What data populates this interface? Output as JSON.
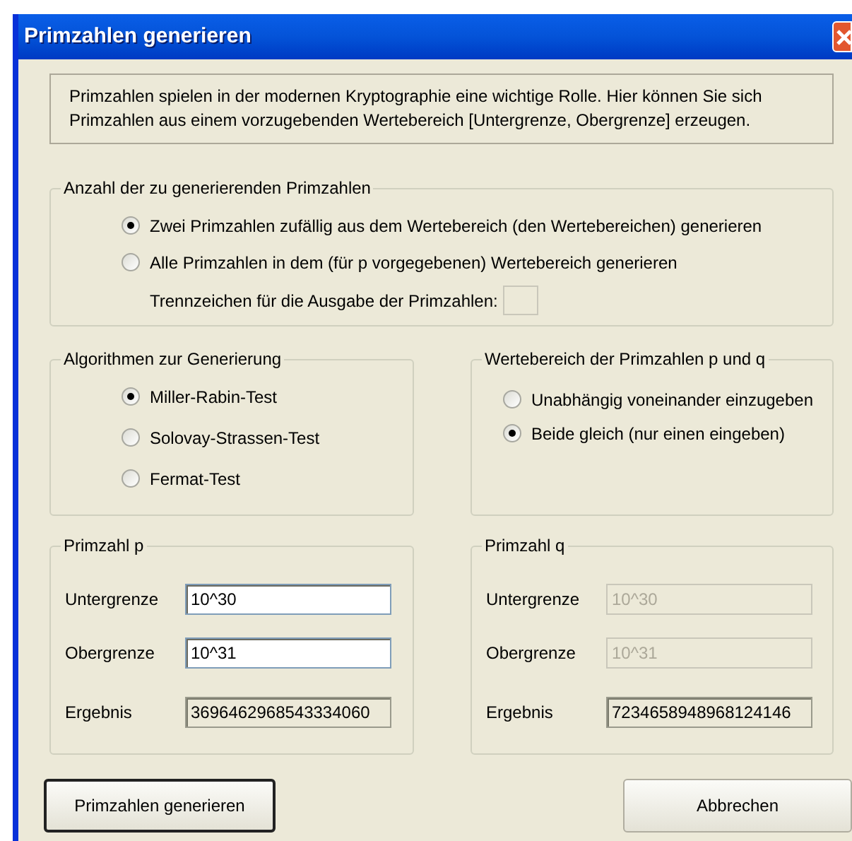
{
  "window": {
    "title": "Primzahlen generieren"
  },
  "intro": {
    "lines": [
      "Primzahlen spielen in der modernen Kryptographie eine wichtige Rolle. Hier können Sie sich",
      "Primzahlen aus einem vorzugebenden Wertebereich [Untergrenze, Obergrenze] erzeugen."
    ]
  },
  "count_group": {
    "title": "Anzahl der zu generierenden Primzahlen",
    "options": [
      {
        "label": "Zwei Primzahlen zufällig aus dem Wertebereich (den Wertebereichen) generieren",
        "selected": true
      },
      {
        "label": "Alle Primzahlen in dem (für p vorgegebenen) Wertebereich generieren",
        "selected": false
      }
    ],
    "separator": {
      "label": "Trennzeichen für die Ausgabe der Primzahlen:",
      "disabled": true
    }
  },
  "algorithm_group": {
    "title": "Algorithmen zur Generierung",
    "options": [
      {
        "label": "Miller-Rabin-Test",
        "selected": true
      },
      {
        "label": "Solovay-Strassen-Test",
        "selected": false
      },
      {
        "label": "Fermat-Test",
        "selected": false
      }
    ]
  },
  "range_group": {
    "title": "Wertebereich der Primzahlen p und q",
    "options": [
      {
        "label": "Unabhängig voneinander einzugeben",
        "selected": false
      },
      {
        "label": "Beide gleich (nur einen eingeben)",
        "selected": true
      }
    ]
  },
  "prime_groups": [
    {
      "title": "Primzahl p",
      "fields": [
        {
          "label": "Untergrenze",
          "value": "10^30",
          "kind": "input",
          "disabled": false
        },
        {
          "label": "Obergrenze",
          "value": "10^31",
          "kind": "input",
          "disabled": false
        },
        {
          "label": "Ergebnis",
          "value": "3696462968543334060",
          "kind": "result"
        }
      ]
    },
    {
      "title": "Primzahl q",
      "fields": [
        {
          "label": "Untergrenze",
          "value": "10^30",
          "kind": "input",
          "disabled": true
        },
        {
          "label": "Obergrenze",
          "value": "10^31",
          "kind": "input",
          "disabled": true
        },
        {
          "label": "Ergebnis",
          "value": "7234658948968124146",
          "kind": "result"
        }
      ]
    }
  ],
  "buttons": [
    {
      "label": "Primzahlen generieren",
      "default": true
    },
    {
      "label": "Abbrechen",
      "default": false
    }
  ]
}
